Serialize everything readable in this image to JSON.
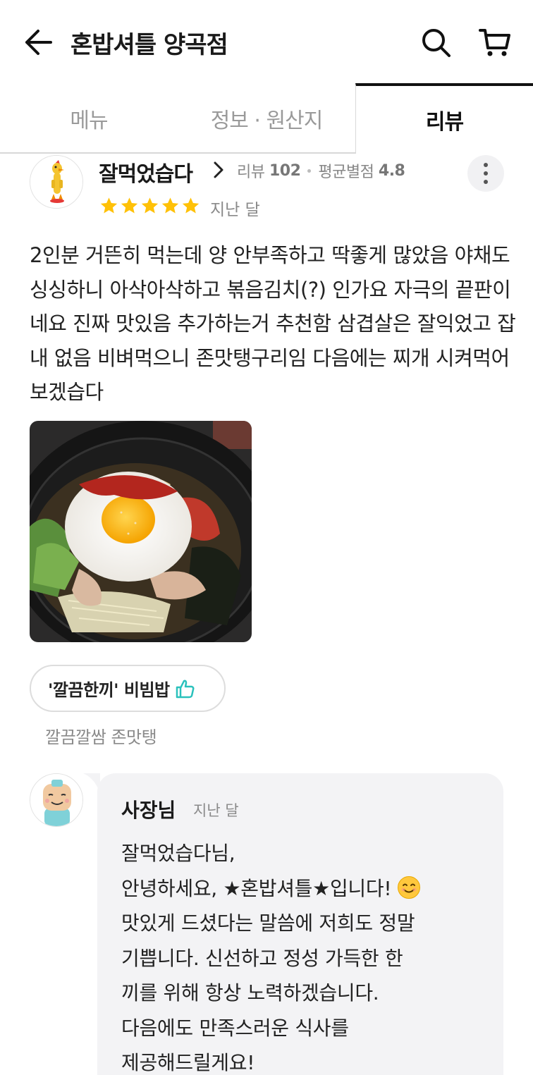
{
  "header": {
    "title": "혼밥셔틀 양곡점",
    "back_icon": "back-arrow-icon",
    "search_icon": "search-icon",
    "cart_icon": "cart-icon"
  },
  "tabs": [
    {
      "label": "메뉴",
      "active": false
    },
    {
      "label": "정보 · 원산지",
      "active": false
    },
    {
      "label": "리뷰",
      "active": true
    }
  ],
  "review": {
    "reviewer_name": "잘먹었습다",
    "review_count_label": "리뷰",
    "review_count": "102",
    "avg_rating_label": "평균별점",
    "avg_rating": "4.8",
    "rating": 5,
    "date": "지난 달",
    "text": "2인분 거뜬히 먹는데 양 안부족하고 딱좋게 많았음  야채도 싱싱하니 아삭아삭하고 볶음김치(?) 인가요 자극의 끝판이네요 진짜 맛있음 추가하는거 추천함 삼겹살은 잘익었고 잡내 없음 비벼먹으니 존맛탱구리임 다음에는 찌개 시켜먹어보겠습다",
    "menu_tag": "'깔끔한끼' 비빔밥",
    "menu_comment": "깔끔깔쌈 존맛탱"
  },
  "owner_reply": {
    "name": "사장님",
    "date": "지난 달",
    "lines": [
      "잘먹었습다님,",
      "안녕하세요, ★혼밥셔틀★입니다!",
      "맛있게 드셨다는 말씀에 저희도 정말",
      "기쁩니다. 신선하고 정성 가득한 한",
      "끼를 위해 항상 노력하겠습니다.",
      "다음에도 만족스러운 식사를",
      "제공해드릴게요!"
    ]
  },
  "colors": {
    "star": "#FFC107",
    "thumb": "#2AC1BC",
    "bubble": "#F3F3F5"
  }
}
